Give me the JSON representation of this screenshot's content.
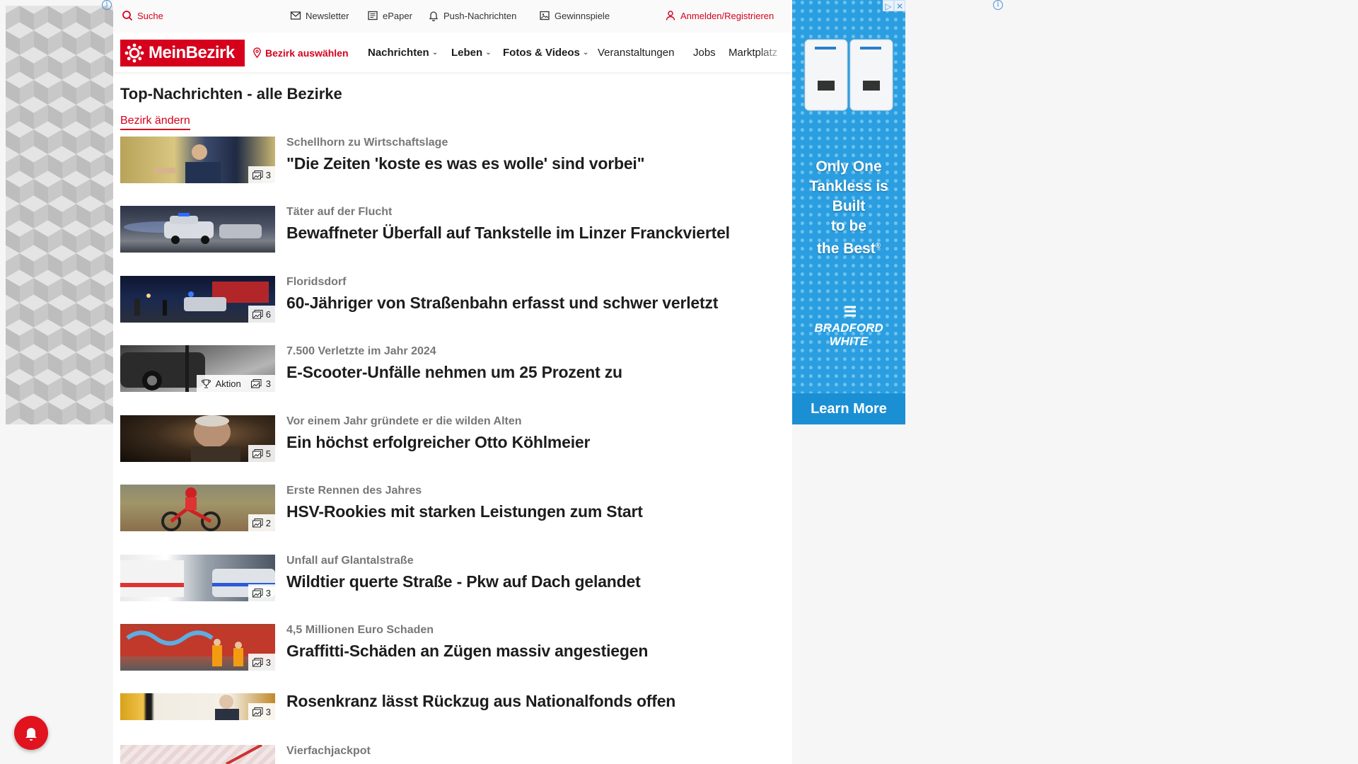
{
  "utility_bar": {
    "search": "Suche",
    "newsletter": "Newsletter",
    "epaper": "ePaper",
    "push": "Push-Nachrichten",
    "gewinnspiele": "Gewinnspiele",
    "login": "Anmelden/Registrieren"
  },
  "navbar": {
    "logo": "MeinBezirk",
    "bezirk": "Bezirk auswählen",
    "items": [
      "Nachrichten",
      "Leben",
      "Fotos & Videos",
      "Veranstaltungen",
      "Jobs",
      "Marktplatz"
    ]
  },
  "section": {
    "title": "Top-Nachrichten - alle Bezirke",
    "change_link": "Bezirk ändern"
  },
  "articles": [
    {
      "kicker": "Schellhorn zu Wirtschaftslage",
      "headline": "\"Die Zeiten 'koste es was es wolle' sind vorbei\"",
      "photos": "3",
      "badge_extra": ""
    },
    {
      "kicker": "Täter auf der Flucht",
      "headline": "Bewaffneter Überfall auf Tankstelle im Linzer Franckviertel",
      "photos": "",
      "badge_extra": ""
    },
    {
      "kicker": "Floridsdorf",
      "headline": "60-Jähriger von Straßenbahn erfasst und schwer verletzt",
      "photos": "6",
      "badge_extra": ""
    },
    {
      "kicker": "7.500 Verletzte im Jahr 2024",
      "headline": "E-Scooter-Unfälle nehmen um 25 Prozent zu",
      "photos": "3",
      "badge_extra": "Aktion"
    },
    {
      "kicker": "Vor einem Jahr gründete er die wilden Alten",
      "headline": "Ein höchst erfolgreicher Otto Köhlmeier",
      "photos": "5",
      "badge_extra": ""
    },
    {
      "kicker": "Erste Rennen des Jahres",
      "headline": "HSV-Rookies mit starken Leistungen zum Start",
      "photos": "2",
      "badge_extra": ""
    },
    {
      "kicker": "Unfall auf Glantalstraße",
      "headline": "Wildtier querte Straße - Pkw auf Dach gelandet",
      "photos": "3",
      "badge_extra": ""
    },
    {
      "kicker": "4,5 Millionen Euro Schaden",
      "headline": "Graffitti-Schäden an Zügen massiv angestiegen",
      "photos": "3",
      "badge_extra": ""
    },
    {
      "kicker": "",
      "headline": "Rosenkranz lässt Rückzug aus Nationalfonds offen",
      "photos": "3",
      "badge_extra": ""
    },
    {
      "kicker": "Vierfachjackpot",
      "headline": "",
      "photos": "",
      "badge_extra": ""
    }
  ],
  "ad": {
    "tagline": [
      "Only One",
      "Tankless is",
      "Built",
      "to be",
      "the Best"
    ],
    "tagline_mark": "®",
    "brand": [
      "BRADFORD",
      "WHITE"
    ],
    "cta": "Learn More",
    "info_icon": "i"
  },
  "colors": {
    "brand_red": "#d6001c",
    "ad_blue": "#2a9ee0"
  }
}
